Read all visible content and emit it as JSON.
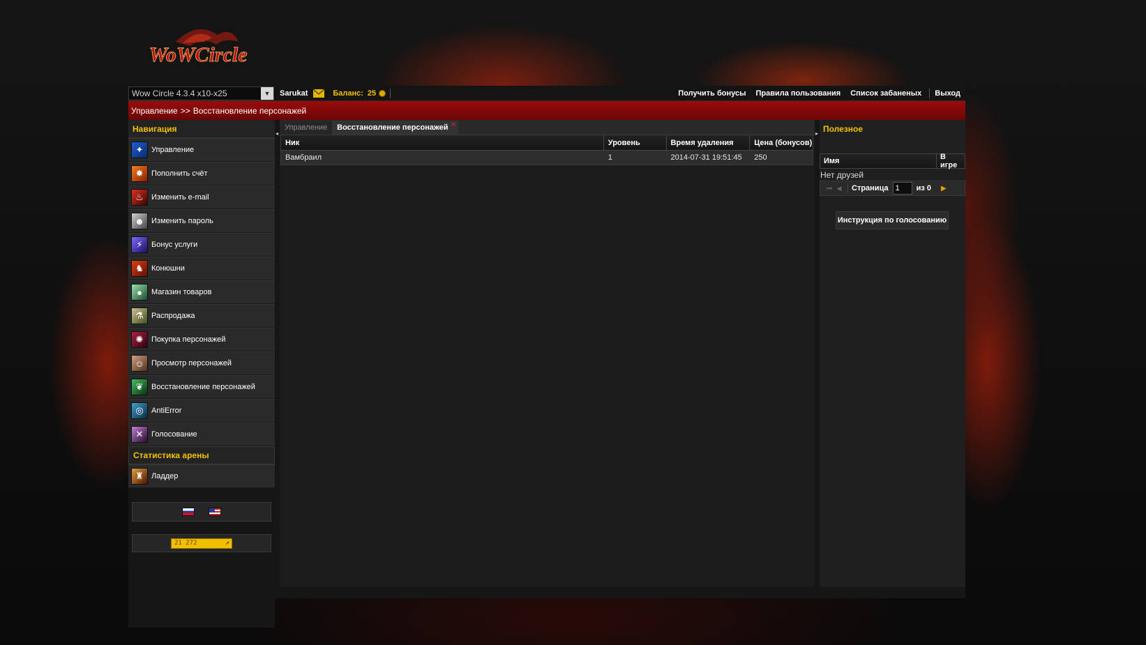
{
  "header": {
    "logo_text": "WoWCircle",
    "realm_select_value": "Wow Circle 4.3.4 x10-x25",
    "username": "Sarukat",
    "balance_label": "Баланс:",
    "balance_value": "25",
    "links": [
      "Получить бонусы",
      "Правила пользования",
      "Список забаненых",
      "Выход"
    ]
  },
  "breadcrumb": {
    "parent": "Управление",
    "separator": ">>",
    "current": "Восстановление персонажей"
  },
  "nav": {
    "title": "Навигация",
    "items": [
      {
        "label": "Управление",
        "icon": "control-icon"
      },
      {
        "label": "Пополнить счёт",
        "icon": "deposit-icon"
      },
      {
        "label": "Изменить e-mail",
        "icon": "email-icon"
      },
      {
        "label": "Изменить пароль",
        "icon": "password-icon"
      },
      {
        "label": "Бонус услуги",
        "icon": "bonus-icon"
      },
      {
        "label": "Конюшни",
        "icon": "stable-icon"
      },
      {
        "label": "Магазин товаров",
        "icon": "shop-icon"
      },
      {
        "label": "Распродажа",
        "icon": "sale-icon"
      },
      {
        "label": "Покупка персонажей",
        "icon": "buy-character-icon"
      },
      {
        "label": "Просмотр персонажей",
        "icon": "view-character-icon"
      },
      {
        "label": "Восстановление персонажей",
        "icon": "restore-character-icon"
      },
      {
        "label": "AntiError",
        "icon": "antierror-icon"
      },
      {
        "label": "Голосование",
        "icon": "vote-icon"
      }
    ],
    "arena_title": "Статистика арены",
    "arena_items": [
      {
        "label": "Ладдер",
        "icon": "ladder-icon"
      }
    ],
    "counter_value": "21 272"
  },
  "center": {
    "tabs": [
      {
        "label": "Управление",
        "active": false
      },
      {
        "label": "Восстановление персонажей",
        "active": true
      }
    ],
    "table": {
      "columns": [
        "Ник",
        "Уровень",
        "Время удаления",
        "Цена (бонусов)"
      ],
      "rows": [
        [
          "Вамбраил",
          "1",
          "2014-07-31 19:51:45",
          "250"
        ]
      ]
    }
  },
  "right": {
    "title": "Полезное",
    "friends_columns": [
      "Имя",
      "В игре"
    ],
    "no_friends": "Нет друзей",
    "pager": {
      "page_label": "Страница",
      "page_value": "1",
      "of_label": "из 0"
    },
    "vote_button": "Инструкция по голосованию"
  },
  "colors": {
    "accent_yellow": "#f2c300",
    "breadcrumb_red": "#9b0c0c",
    "background": "#0b0b0b"
  }
}
